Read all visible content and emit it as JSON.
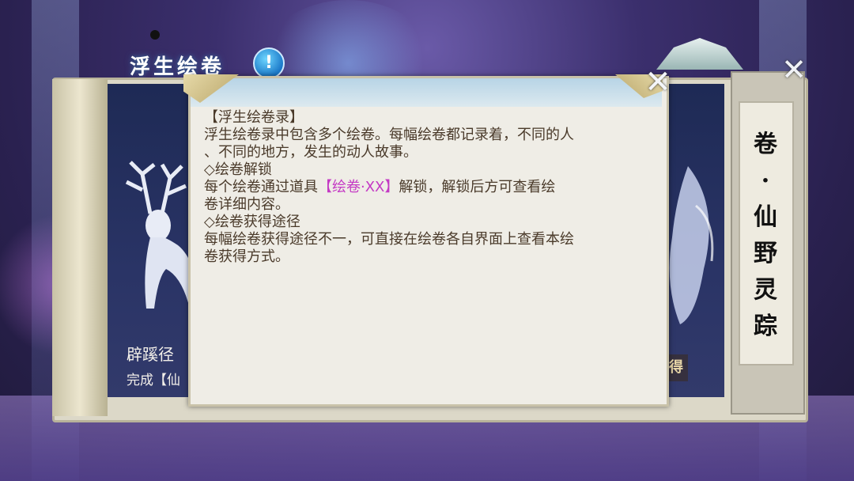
{
  "header": {
    "title": "浮生绘卷",
    "info_icon": "!"
  },
  "dialog": {
    "close_icon": "✕",
    "lines": [
      {
        "pre": "【浮生绘卷录】",
        "hl": "",
        "post": ""
      },
      {
        "pre": "浮生绘卷录中包含多个绘卷。每幅绘卷都记录着，不同的人",
        "hl": "",
        "post": ""
      },
      {
        "pre": "、不同的地方，发生的动人故事。",
        "hl": "",
        "post": ""
      },
      {
        "pre": "◇绘卷解锁",
        "hl": "",
        "post": ""
      },
      {
        "pre": "每个绘卷通过道具",
        "hl": "【绘卷·XX】",
        "post": "解锁，解锁后方可查看绘"
      },
      {
        "pre": "卷详细内容。",
        "hl": "",
        "post": ""
      },
      {
        "pre": "◇绘卷获得途径",
        "hl": "",
        "post": ""
      },
      {
        "pre": "每幅绘卷获得途径不一，可直接在绘卷各自界面上查看本绘",
        "hl": "",
        "post": ""
      },
      {
        "pre": "卷获得方式。",
        "hl": "",
        "post": ""
      }
    ]
  },
  "card": {
    "name": "辟蹊径",
    "sub": "完成【仙",
    "btn": "得"
  },
  "side": {
    "title": "卷·仙野灵踪",
    "close_icon": "✕"
  },
  "colors": {
    "highlight": "#c43ac4",
    "text": "#4a3a2a"
  }
}
